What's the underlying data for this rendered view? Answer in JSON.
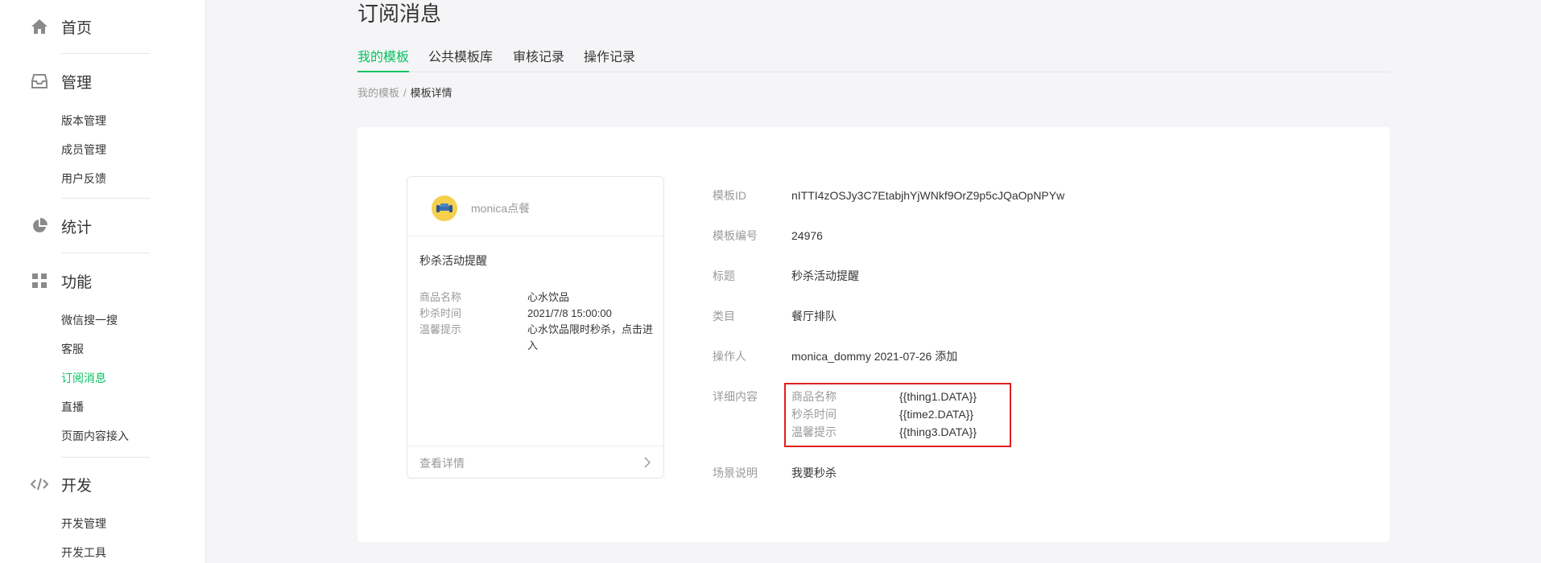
{
  "sidebar": {
    "home": {
      "label": "首页"
    },
    "manage": {
      "label": "管理",
      "items": [
        "版本管理",
        "成员管理",
        "用户反馈"
      ]
    },
    "stats": {
      "label": "统计"
    },
    "features": {
      "label": "功能",
      "items": [
        "微信搜一搜",
        "客服",
        "订阅消息",
        "直播",
        "页面内容接入"
      ],
      "active": "订阅消息"
    },
    "dev": {
      "label": "开发",
      "items": [
        "开发管理",
        "开发工具"
      ]
    }
  },
  "page": {
    "title": "订阅消息"
  },
  "tabs": [
    {
      "label": "我的模板",
      "active": true
    },
    {
      "label": "公共模板库",
      "active": false
    },
    {
      "label": "审核记录",
      "active": false
    },
    {
      "label": "操作记录",
      "active": false
    }
  ],
  "breadcrumb": {
    "parent": "我的模板",
    "separator": "/",
    "current": "模板详情"
  },
  "preview": {
    "app_name": "monica点餐",
    "title": "秒杀活动提醒",
    "fields": [
      {
        "key": "商品名称",
        "value": "心水饮品"
      },
      {
        "key": "秒杀时间",
        "value": "2021/7/8 15:00:00"
      },
      {
        "key": "温馨提示",
        "value": "心水饮品限时秒杀，点击进入"
      }
    ],
    "footer_label": "查看详情"
  },
  "details": {
    "template_id": {
      "label": "模板ID",
      "value": "nITTI4zOSJy3C7EtabjhYjWNkf9OrZ9p5cJQaOpNPYw"
    },
    "template_no": {
      "label": "模板编号",
      "value": "24976"
    },
    "title": {
      "label": "标题",
      "value": "秒杀活动提醒"
    },
    "category": {
      "label": "类目",
      "value": "餐厅排队"
    },
    "operator": {
      "label": "操作人",
      "value": "monica_dommy 2021-07-26 添加"
    },
    "content": {
      "label": "详细内容",
      "rows": [
        {
          "key": "商品名称",
          "value": "{{thing1.DATA}}"
        },
        {
          "key": "秒杀时间",
          "value": "{{time2.DATA}}"
        },
        {
          "key": "温馨提示",
          "value": "{{thing3.DATA}}"
        }
      ]
    },
    "scene": {
      "label": "场景说明",
      "value": "我要秒杀"
    }
  },
  "colors": {
    "accent": "#07c160",
    "highlight_border": "#e02020",
    "muted": "#9a9a9a",
    "text": "#353535"
  },
  "icons": [
    "home-icon",
    "inbox-icon",
    "pie-chart-icon",
    "grid-icon",
    "code-icon",
    "chevron-right-icon"
  ]
}
